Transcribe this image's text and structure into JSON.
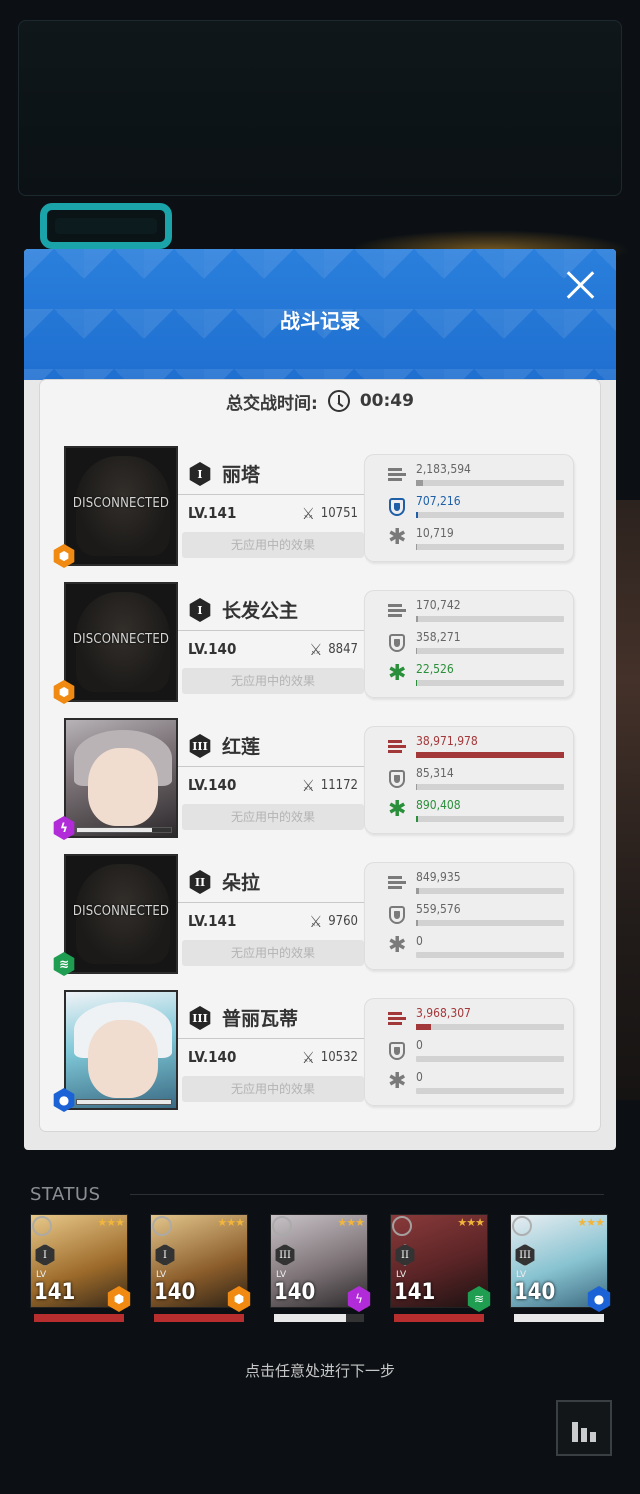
{
  "modal": {
    "title": "战斗记录",
    "time_label": "总交战时间:",
    "time_value": "00:49"
  },
  "colors": {
    "header_blue": "#2a7fdc",
    "damage_red": "#a3383a",
    "shield_blue": "#1f5fa8",
    "heal_green": "#2a8f3a"
  },
  "characters": [
    {
      "name": "丽塔",
      "burst": "I",
      "level": "LV.141",
      "power": "10751",
      "effect": "无应用中的效果",
      "portrait_status": "DISCONNECTED",
      "element": "fire-icon",
      "damage": {
        "value": "2,183,594",
        "fraction": 0.05
      },
      "shield": {
        "value": "707,216",
        "fraction": 0.015
      },
      "heal": {
        "value": "10,719",
        "fraction": 0.002
      }
    },
    {
      "name": "长发公主",
      "burst": "I",
      "level": "LV.140",
      "power": "8847",
      "effect": "无应用中的效果",
      "portrait_status": "DISCONNECTED",
      "element": "fire-icon",
      "damage": {
        "value": "170,742",
        "fraction": 0.004
      },
      "shield": {
        "value": "358,271",
        "fraction": 0.008
      },
      "heal": {
        "value": "22,526",
        "fraction": 0.003
      }
    },
    {
      "name": "红莲",
      "burst": "III",
      "level": "LV.140",
      "power": "11172",
      "effect": "无应用中的效果",
      "portrait_status": "",
      "element": "electric-icon",
      "damage": {
        "value": "38,971,978",
        "fraction": 1.0
      },
      "shield": {
        "value": "85,314",
        "fraction": 0.002
      },
      "heal": {
        "value": "890,408",
        "fraction": 0.015
      }
    },
    {
      "name": "朵拉",
      "burst": "II",
      "level": "LV.141",
      "power": "9760",
      "effect": "无应用中的效果",
      "portrait_status": "DISCONNECTED",
      "element": "wind-icon",
      "damage": {
        "value": "849,935",
        "fraction": 0.02
      },
      "shield": {
        "value": "559,576",
        "fraction": 0.012
      },
      "heal": {
        "value": "0",
        "fraction": 0
      }
    },
    {
      "name": "普丽瓦蒂",
      "burst": "III",
      "level": "LV.140",
      "power": "10532",
      "effect": "无应用中的效果",
      "portrait_status": "",
      "element": "water-icon",
      "damage": {
        "value": "3,968,307",
        "fraction": 0.1
      },
      "shield": {
        "value": "0",
        "fraction": 0
      },
      "heal": {
        "value": "0",
        "fraction": 0
      }
    }
  ],
  "status": {
    "label": "STATUS",
    "team": [
      {
        "burst": "I",
        "level": "141",
        "lv_tag": "LV",
        "element": "fire-icon",
        "hp_fraction": 1.0
      },
      {
        "burst": "I",
        "level": "140",
        "lv_tag": "LV",
        "element": "fire-icon",
        "hp_fraction": 1.0
      },
      {
        "burst": "III",
        "level": "140",
        "lv_tag": "LV",
        "element": "electric-icon",
        "hp_fraction": 0.8
      },
      {
        "burst": "II",
        "level": "141",
        "lv_tag": "LV",
        "element": "wind-icon",
        "hp_fraction": 1.0
      },
      {
        "burst": "III",
        "level": "140",
        "lv_tag": "LV",
        "element": "water-icon",
        "hp_fraction": 1.0
      }
    ]
  },
  "hint": "点击任意处进行下一步"
}
